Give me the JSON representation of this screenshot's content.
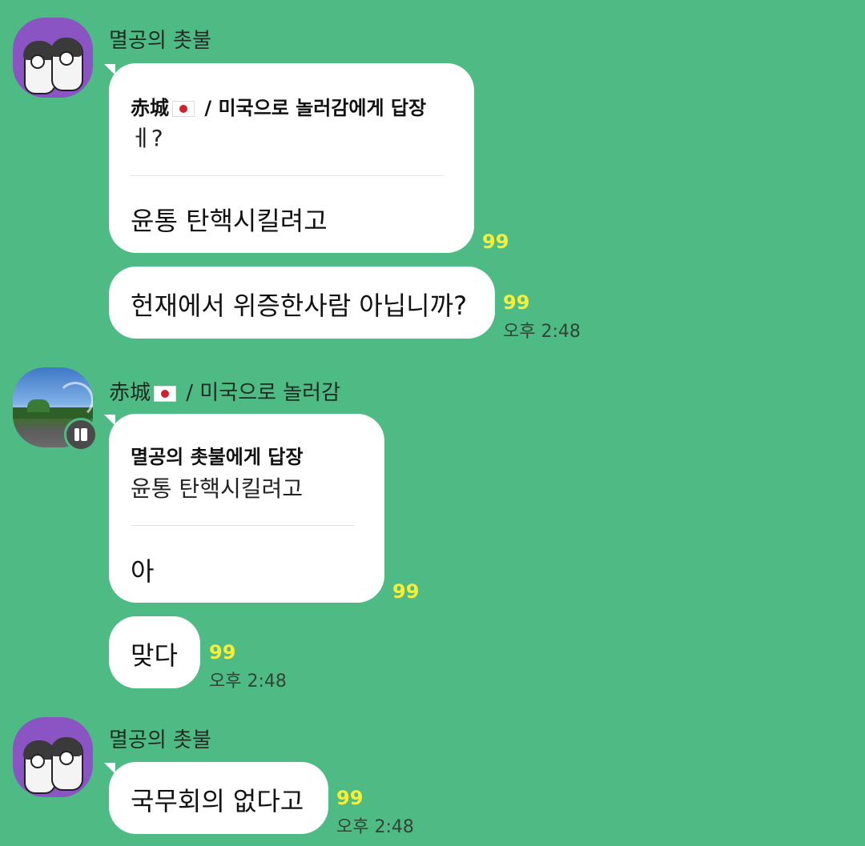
{
  "messages": [
    {
      "sender": "멸공의 촛불",
      "reply": {
        "to_prefix": "赤城",
        "to_suffix": " / 미국으로 놀러감에게 답장",
        "quote": "ㅔ?"
      },
      "text": "윤통 탄핵시킬려고",
      "unread": "99"
    },
    {
      "text": "헌재에서 위증한사람 아닙니까?",
      "unread": "99",
      "time": "오후 2:48"
    },
    {
      "sender_prefix": "赤城",
      "sender_suffix": " / 미국으로 놀러감",
      "reply": {
        "head": "멸공의 촛불에게 답장",
        "quote": "윤통 탄핵시킬려고"
      },
      "text": "아",
      "unread": "99"
    },
    {
      "text": "맞다",
      "unread": "99",
      "time": "오후 2:48"
    },
    {
      "sender": "멸공의 촛불",
      "text": "국무회의 없다고",
      "unread": "99",
      "time": "오후 2:48"
    }
  ],
  "icons": {
    "avatar_1": "penguin-avatar-icon",
    "avatar_2": "landscape-avatar-icon",
    "flag": "japan-flag-icon",
    "badge": "profile-badge-icon"
  },
  "colors": {
    "background": "#4fbb84",
    "bubble": "#ffffff",
    "unread": "#f5ee3a"
  }
}
